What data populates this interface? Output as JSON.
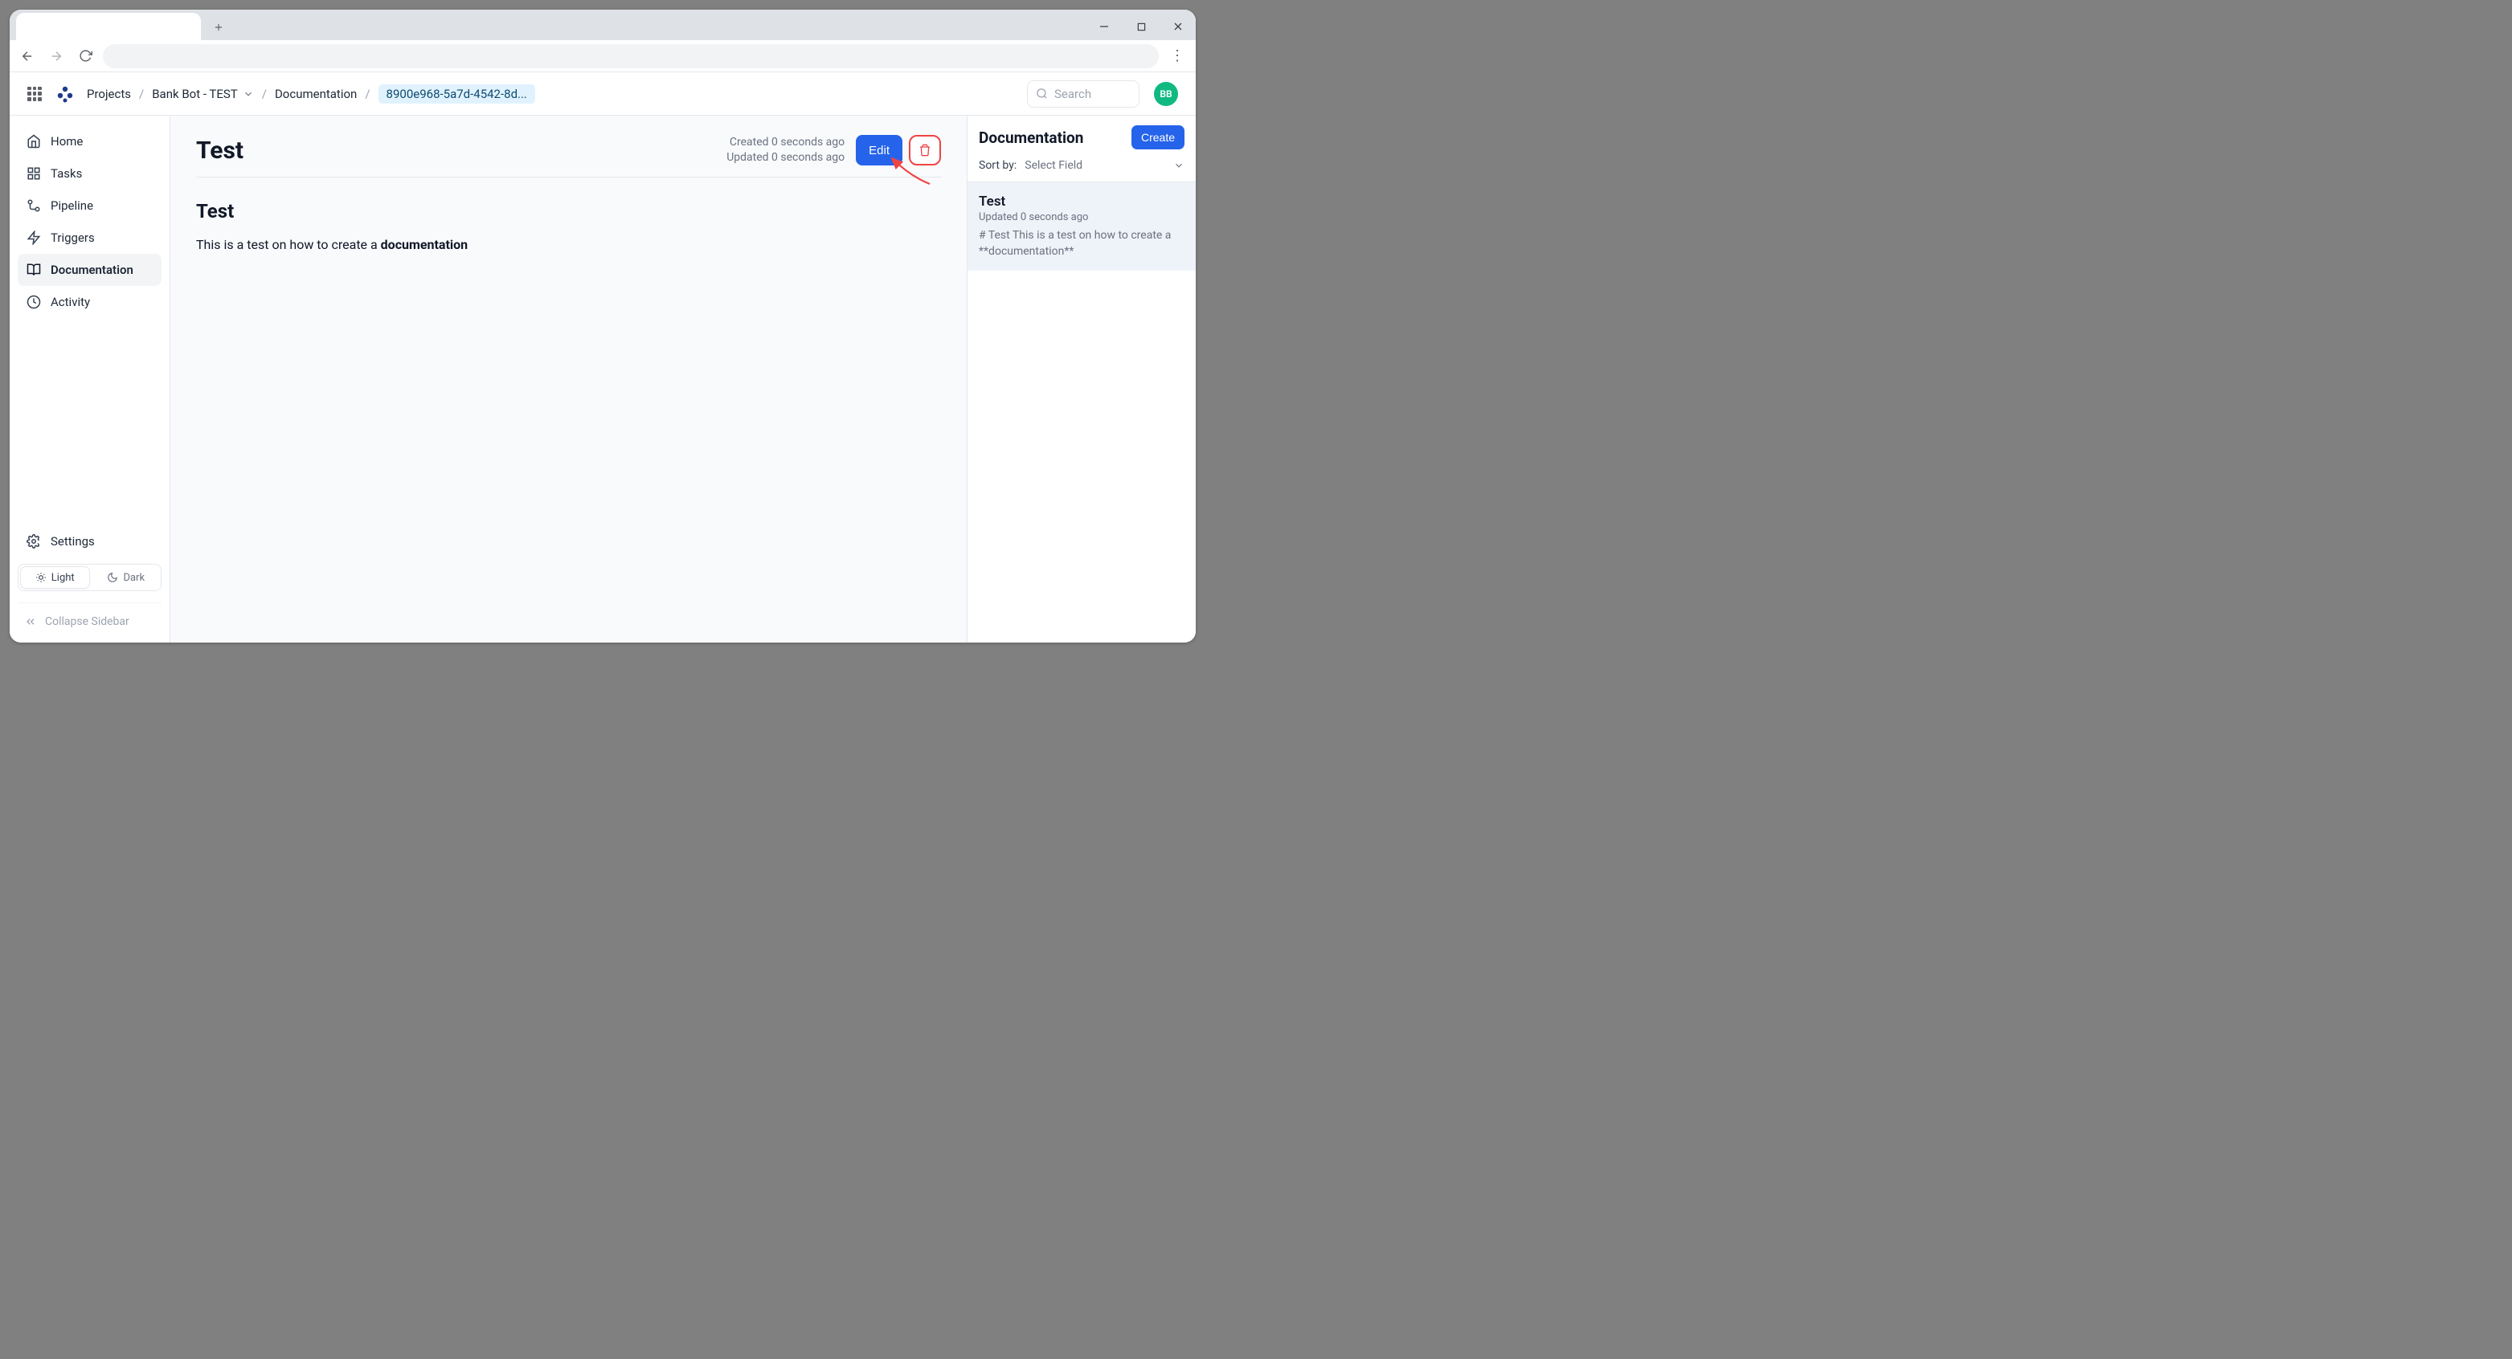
{
  "browser": {
    "window_controls": {
      "minimize": "—",
      "maximize": "☐",
      "close": "✕"
    }
  },
  "header": {
    "breadcrumb": {
      "projects": "Projects",
      "project_name": "Bank Bot - TEST",
      "section": "Documentation",
      "doc_id": "8900e968-5a7d-4542-8d..."
    },
    "search_placeholder": "Search",
    "avatar_initials": "BB"
  },
  "sidebar": {
    "items": {
      "home": "Home",
      "tasks": "Tasks",
      "pipeline": "Pipeline",
      "triggers": "Triggers",
      "documentation": "Documentation",
      "activity": "Activity",
      "settings": "Settings"
    },
    "theme": {
      "light": "Light",
      "dark": "Dark"
    },
    "collapse": "Collapse Sidebar"
  },
  "document": {
    "title": "Test",
    "created": "Created 0 seconds ago",
    "updated": "Updated 0 seconds ago",
    "edit_label": "Edit",
    "body_title": "Test",
    "body_text_prefix": "This is a test on how to create a ",
    "body_text_bold": "documentation"
  },
  "right_panel": {
    "title": "Documentation",
    "create_label": "Create",
    "sort_label": "Sort by:",
    "sort_placeholder": "Select Field",
    "items": [
      {
        "title": "Test",
        "updated": "Updated 0 seconds ago",
        "preview": "# Test This is a test on how to create a **documentation**"
      }
    ]
  }
}
